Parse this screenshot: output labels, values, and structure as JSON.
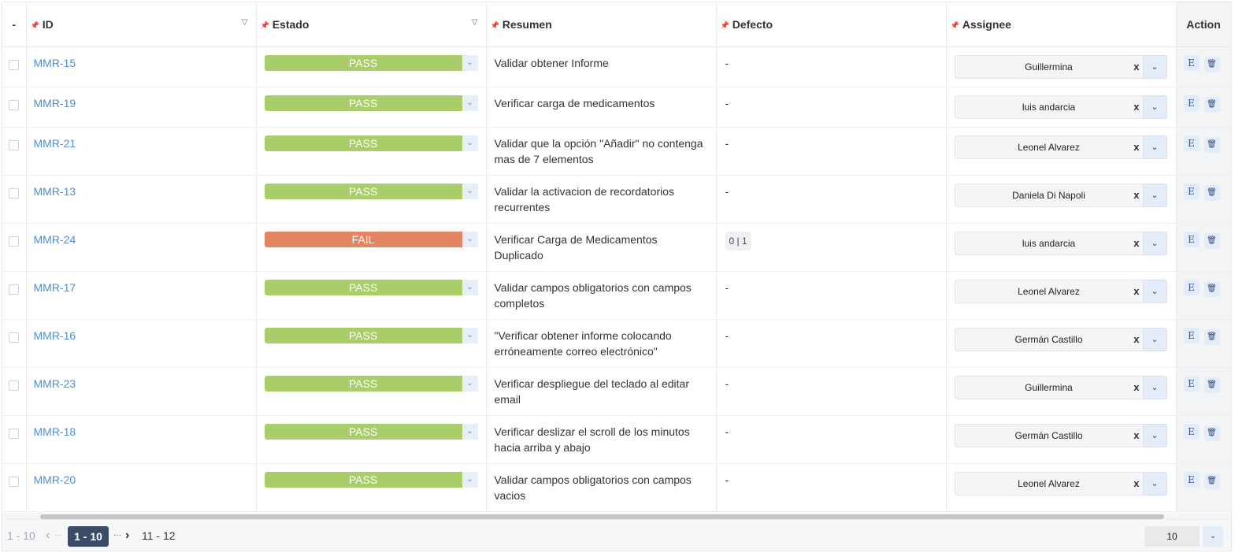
{
  "columns": {
    "select": "-",
    "id": "ID",
    "estado": "Estado",
    "resumen": "Resumen",
    "defecto": "Defecto",
    "assignee": "Assignee",
    "action": "Action"
  },
  "colors": {
    "pass": "#a9cd68",
    "fail": "#e38463",
    "link": "#4d8fd6",
    "pager_active": "#3b4c67"
  },
  "icons": {
    "pin": "pin-icon",
    "sort": "chevron-down-icon",
    "edit": "edit-icon",
    "delete": "trash-icon"
  },
  "rows": [
    {
      "id": "MMR-15",
      "estado": "PASS",
      "resumen": "Validar obtener Informe",
      "defecto": "-",
      "assignee": "Guillermina"
    },
    {
      "id": "MMR-19",
      "estado": "PASS",
      "resumen": "Verificar carga de medicamentos",
      "defecto": "-",
      "assignee": "luis andarcia"
    },
    {
      "id": "MMR-21",
      "estado": "PASS",
      "resumen": "Validar que la opción \"Añadir\" no contenga mas de 7 elementos",
      "defecto": "-",
      "assignee": "Leonel Alvarez"
    },
    {
      "id": "MMR-13",
      "estado": "PASS",
      "resumen": "Validar la activacion de recordatorios recurrentes",
      "defecto": "-",
      "assignee": "Daniela Di Napoli"
    },
    {
      "id": "MMR-24",
      "estado": "FAIL",
      "resumen": "Verificar Carga de Medicamentos Duplicado",
      "defecto": "0 | 1",
      "assignee": "luis andarcia"
    },
    {
      "id": "MMR-17",
      "estado": "PASS",
      "resumen": "Validar campos obligatorios con campos completos",
      "defecto": "-",
      "assignee": "Leonel Alvarez"
    },
    {
      "id": "MMR-16",
      "estado": "PASS",
      "resumen": "\"Verificar obtener informe colocando erróneamente correo electrónico\"",
      "defecto": "-",
      "assignee": "Germán Castillo"
    },
    {
      "id": "MMR-23",
      "estado": "PASS",
      "resumen": "Verificar despliegue del teclado al editar email",
      "defecto": "-",
      "assignee": "Guillermina"
    },
    {
      "id": "MMR-18",
      "estado": "PASS",
      "resumen": "Verificar deslizar el scroll de los minutos hacia arriba y abajo",
      "defecto": "-",
      "assignee": "Germán Castillo"
    },
    {
      "id": "MMR-20",
      "estado": "PASS",
      "resumen": "Validar campos obligatorios con campos vacios",
      "defecto": "-",
      "assignee": "Leonel Alvarez"
    }
  ],
  "row_actions": {
    "edit_label": "E",
    "delete_symbol": "🗑",
    "clear_symbol": "x",
    "dropdown_symbol": "⌄"
  },
  "pager": {
    "prev_range": "1 - 10",
    "prev_arrow": "‹",
    "prev_dots": "···",
    "current": "1 - 10",
    "next_dots": "···",
    "next_arrow": "›",
    "next_range": "11 - 12",
    "page_size": "10"
  }
}
